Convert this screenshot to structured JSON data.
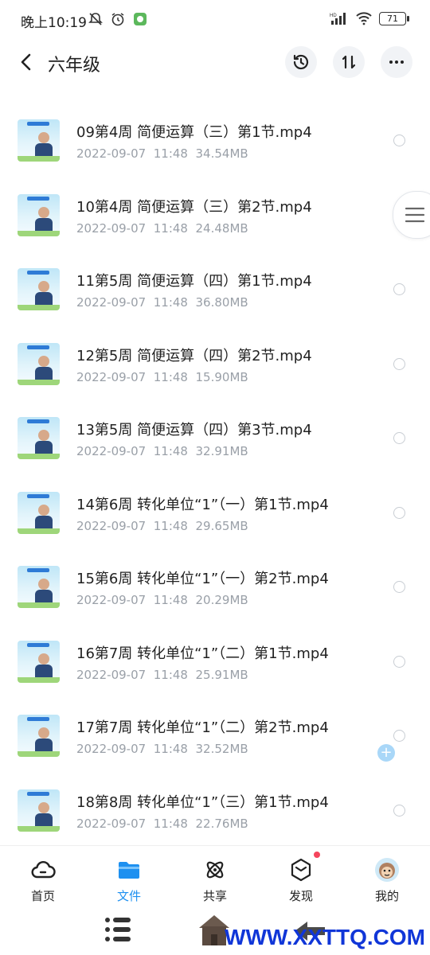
{
  "status_bar": {
    "time": "晚上10:19",
    "battery": "71"
  },
  "header": {
    "title": "六年级"
  },
  "files": [
    {
      "name": "09第4周 简便运算（三）第1节.mp4",
      "date": "2022-09-07",
      "time": "11:48",
      "size": "34.54MB"
    },
    {
      "name": "10第4周 简便运算（三）第2节.mp4",
      "date": "2022-09-07",
      "time": "11:48",
      "size": "24.48MB"
    },
    {
      "name": "11第5周 简便运算（四）第1节.mp4",
      "date": "2022-09-07",
      "time": "11:48",
      "size": "36.80MB"
    },
    {
      "name": "12第5周 简便运算（四）第2节.mp4",
      "date": "2022-09-07",
      "time": "11:48",
      "size": "15.90MB"
    },
    {
      "name": "13第5周 简便运算（四）第3节.mp4",
      "date": "2022-09-07",
      "time": "11:48",
      "size": "32.91MB"
    },
    {
      "name": "14第6周 转化单位“1”（一）第1节.mp4",
      "date": "2022-09-07",
      "time": "11:48",
      "size": "29.65MB"
    },
    {
      "name": "15第6周 转化单位“1”（一）第2节.mp4",
      "date": "2022-09-07",
      "time": "11:48",
      "size": "20.29MB"
    },
    {
      "name": "16第7周 转化单位“1”（二）第1节.mp4",
      "date": "2022-09-07",
      "time": "11:48",
      "size": "25.91MB"
    },
    {
      "name": "17第7周 转化单位“1”（二）第2节.mp4",
      "date": "2022-09-07",
      "time": "11:48",
      "size": "32.52MB"
    },
    {
      "name": "18第8周 转化单位“1”（三）第1节.mp4",
      "date": "2022-09-07",
      "time": "11:48",
      "size": "22.76MB"
    }
  ],
  "bottom_nav": {
    "home": "首页",
    "files": "文件",
    "share": "共享",
    "discover": "发现",
    "mine": "我的"
  },
  "watermark": "WWW.XXTTQ.COM",
  "colors": {
    "accent": "#1e90f0",
    "meta_text": "#9aa0a8",
    "badge": "#f5455c"
  }
}
